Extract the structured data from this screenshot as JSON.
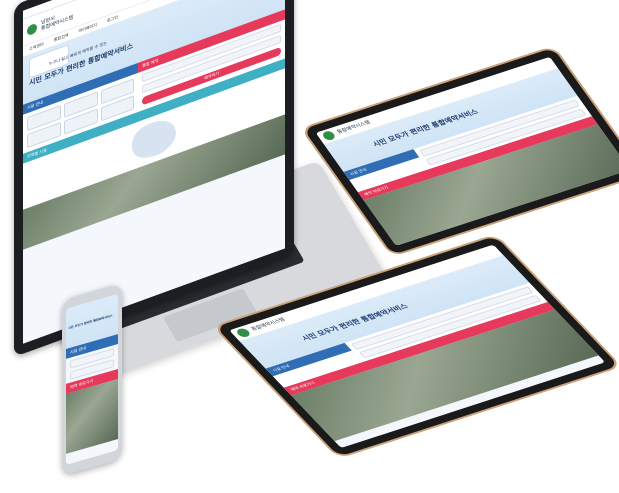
{
  "site": {
    "org_name": "남원시",
    "system_name": "통합예약시스템",
    "nav": [
      "고객센터",
      "통합검색",
      "마이페이지",
      "로그인"
    ],
    "hero_kicker": "누구나 쉽고 빠르게 예약할 수 있는",
    "hero_title": "시민 모두가 편리한 통합예약서비스",
    "panel_tab_left": "시설 안내",
    "panel_tab_right": "통합 예약",
    "search_button": "예약하기",
    "region_tab": "지역별 시설",
    "reserve_tab": "예약 바로가기"
  },
  "colors": {
    "brand_blue": "#2f6db5",
    "brand_red": "#e7395b",
    "brand_teal": "#3fb0c4",
    "brand_green": "#2f8f46",
    "tablet_frame": "#caa27a"
  },
  "devices": [
    "laptop",
    "tablet-top",
    "tablet-bottom",
    "phone"
  ]
}
